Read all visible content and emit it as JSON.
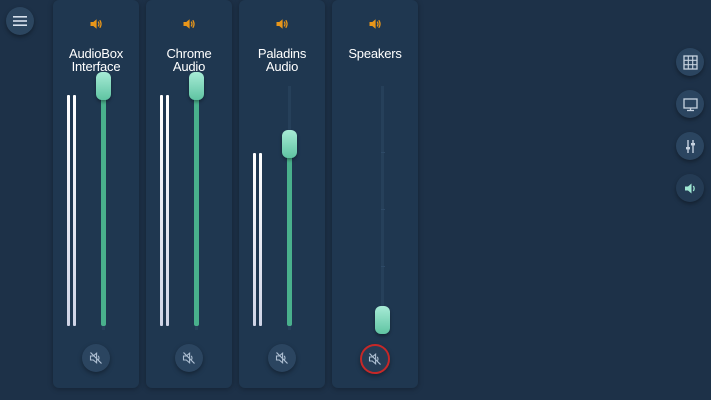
{
  "toolbar": {
    "menu_icon": "hamburger-menu-icon"
  },
  "channels": [
    {
      "label": "AudioBox Interface",
      "volume_fraction": 1.0,
      "meter_fraction": 1.0,
      "muted": false,
      "icon": "speaker-icon"
    },
    {
      "label": "Chrome Audio",
      "volume_fraction": 1.0,
      "meter_fraction": 1.0,
      "muted": false,
      "icon": "speaker-icon"
    },
    {
      "label": "Paladins Audio",
      "volume_fraction": 0.76,
      "meter_fraction": 0.76,
      "muted": false,
      "icon": "speaker-icon"
    },
    {
      "label": "Speakers",
      "volume_fraction": 0.0,
      "meter_fraction": 0.0,
      "muted": true,
      "icon": "speaker-icon"
    }
  ],
  "side_nav": [
    {
      "icon": "grid-icon",
      "active": false
    },
    {
      "icon": "monitor-icon",
      "active": false
    },
    {
      "icon": "equalizer-icon",
      "active": false
    },
    {
      "icon": "volume-icon",
      "active": true
    }
  ],
  "colors": {
    "background": "#1d3148",
    "strip": "#1f3750",
    "accent_orange": "#e8961a",
    "fader_green": "#49b08c",
    "thumb_teal": "#8fe0c6",
    "mute_highlight": "#c62828"
  }
}
